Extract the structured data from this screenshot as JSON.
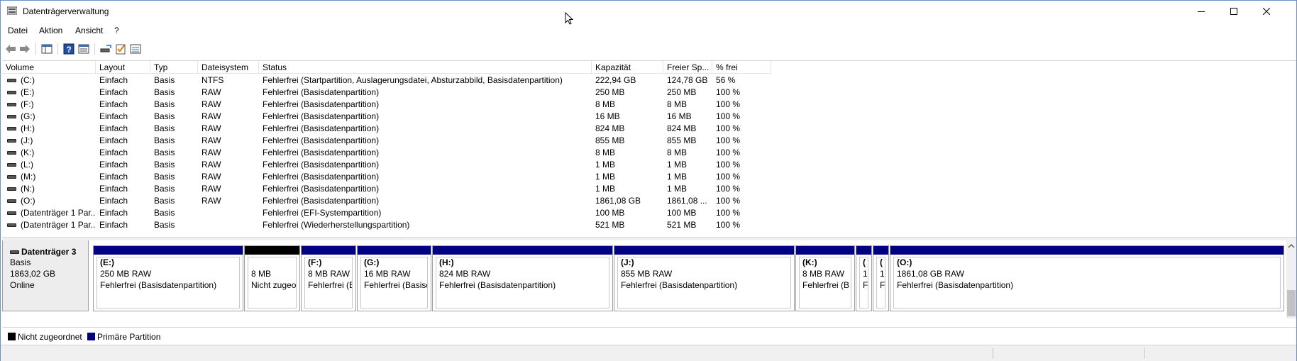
{
  "window": {
    "title": "Datenträgerverwaltung"
  },
  "icons": {
    "minimize": "minimize-icon",
    "maximize": "maximize-icon",
    "close": "close-icon"
  },
  "menu": {
    "items": [
      "Datei",
      "Aktion",
      "Ansicht",
      "?"
    ]
  },
  "volume_list": {
    "columns": [
      "Volume",
      "Layout",
      "Typ",
      "Dateisystem",
      "Status",
      "Kapazität",
      "Freier Sp...",
      "% frei"
    ],
    "rows": [
      [
        "(C:)",
        "Einfach",
        "Basis",
        "NTFS",
        "Fehlerfrei (Startpartition, Auslagerungsdatei, Absturzabbild, Basisdatenpartition)",
        "222,94 GB",
        "124,78 GB",
        "56 %"
      ],
      [
        "(E:)",
        "Einfach",
        "Basis",
        "RAW",
        "Fehlerfrei (Basisdatenpartition)",
        "250 MB",
        "250 MB",
        "100 %"
      ],
      [
        "(F:)",
        "Einfach",
        "Basis",
        "RAW",
        "Fehlerfrei (Basisdatenpartition)",
        "8 MB",
        "8 MB",
        "100 %"
      ],
      [
        "(G:)",
        "Einfach",
        "Basis",
        "RAW",
        "Fehlerfrei (Basisdatenpartition)",
        "16 MB",
        "16 MB",
        "100 %"
      ],
      [
        "(H:)",
        "Einfach",
        "Basis",
        "RAW",
        "Fehlerfrei (Basisdatenpartition)",
        "824 MB",
        "824 MB",
        "100 %"
      ],
      [
        "(J:)",
        "Einfach",
        "Basis",
        "RAW",
        "Fehlerfrei (Basisdatenpartition)",
        "855 MB",
        "855 MB",
        "100 %"
      ],
      [
        "(K:)",
        "Einfach",
        "Basis",
        "RAW",
        "Fehlerfrei (Basisdatenpartition)",
        "8 MB",
        "8 MB",
        "100 %"
      ],
      [
        "(L:)",
        "Einfach",
        "Basis",
        "RAW",
        "Fehlerfrei (Basisdatenpartition)",
        "1 MB",
        "1 MB",
        "100 %"
      ],
      [
        "(M:)",
        "Einfach",
        "Basis",
        "RAW",
        "Fehlerfrei (Basisdatenpartition)",
        "1 MB",
        "1 MB",
        "100 %"
      ],
      [
        "(N:)",
        "Einfach",
        "Basis",
        "RAW",
        "Fehlerfrei (Basisdatenpartition)",
        "1 MB",
        "1 MB",
        "100 %"
      ],
      [
        "(O:)",
        "Einfach",
        "Basis",
        "RAW",
        "Fehlerfrei (Basisdatenpartition)",
        "1861,08 GB",
        "1861,08 ...",
        "100 %"
      ],
      [
        "(Datenträger 1 Par...",
        "Einfach",
        "Basis",
        "",
        "Fehlerfrei (EFI-Systempartition)",
        "100 MB",
        "100 MB",
        "100 %"
      ],
      [
        "(Datenträger 1 Par...",
        "Einfach",
        "Basis",
        "",
        "Fehlerfrei (Wiederherstellungspartition)",
        "521 MB",
        "521 MB",
        "100 %"
      ]
    ]
  },
  "disk": {
    "name": "Datenträger 3",
    "type": "Basis",
    "size": "1863,02 GB",
    "state": "Online"
  },
  "partitions": [
    {
      "label": "(E:)",
      "size": "250 MB RAW",
      "status": "Fehlerfrei (Basisdatenpartition)",
      "kind": "primary"
    },
    {
      "label": "",
      "size": "8 MB",
      "status": "Nicht zugeor",
      "kind": "unallocated"
    },
    {
      "label": "(F:)",
      "size": "8 MB RAW",
      "status": "Fehlerfrei (B",
      "kind": "primary"
    },
    {
      "label": "(G:)",
      "size": "16 MB RAW",
      "status": "Fehlerfrei (Basisd",
      "kind": "primary"
    },
    {
      "label": "(H:)",
      "size": "824 MB RAW",
      "status": "Fehlerfrei (Basisdatenpartition)",
      "kind": "primary"
    },
    {
      "label": "(J:)",
      "size": "855 MB RAW",
      "status": "Fehlerfrei (Basisdatenpartition)",
      "kind": "primary"
    },
    {
      "label": "(K:)",
      "size": "8 MB RAW",
      "status": "Fehlerfrei (B",
      "kind": "primary"
    },
    {
      "label": "(",
      "size": "1",
      "status": "Fe",
      "kind": "primary"
    },
    {
      "label": "(",
      "size": "1",
      "status": "Fe",
      "kind": "primary"
    },
    {
      "label": "(O:)",
      "size": "1861,08 GB RAW",
      "status": "Fehlerfrei (Basisdatenpartition)",
      "kind": "primary"
    }
  ],
  "legend": {
    "items": [
      {
        "label": "Nicht zugeordnet",
        "color": "#000000"
      },
      {
        "label": "Primäre Partition",
        "color": "#000080"
      }
    ]
  },
  "colors": {
    "primary_partition": "#000080",
    "unallocated": "#000000"
  }
}
